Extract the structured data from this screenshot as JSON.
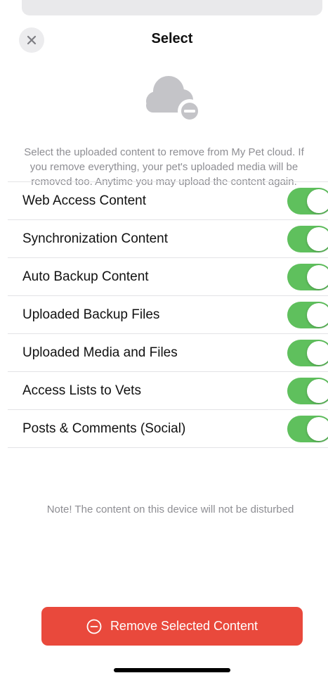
{
  "header": {
    "title": "Select",
    "close_icon": "close-icon"
  },
  "illustration": {
    "icon": "cloud-remove-icon"
  },
  "description": {
    "line1": "Select the uploaded content to remove from My Pet cloud. If",
    "line2": "you remove everything, your pet's uploaded media will be",
    "line3": "removed too. Anytime you may upload the content again."
  },
  "options": [
    {
      "label": "Web Access Content",
      "enabled": true
    },
    {
      "label": "Synchronization Content",
      "enabled": true
    },
    {
      "label": "Auto Backup Content",
      "enabled": true
    },
    {
      "label": "Uploaded Backup Files",
      "enabled": true
    },
    {
      "label": "Uploaded Media and Files",
      "enabled": true
    },
    {
      "label": "Access Lists to Vets",
      "enabled": true
    },
    {
      "label": "Posts & Comments (Social)",
      "enabled": true
    }
  ],
  "note": "Note! The content on this device will not be disturbed",
  "action": {
    "label": "Remove Selected Content",
    "icon": "minus-circle-icon"
  },
  "colors": {
    "toggle_on": "#5fc05d",
    "danger": "#e9493c",
    "secondary_text": "#8e8e93"
  }
}
